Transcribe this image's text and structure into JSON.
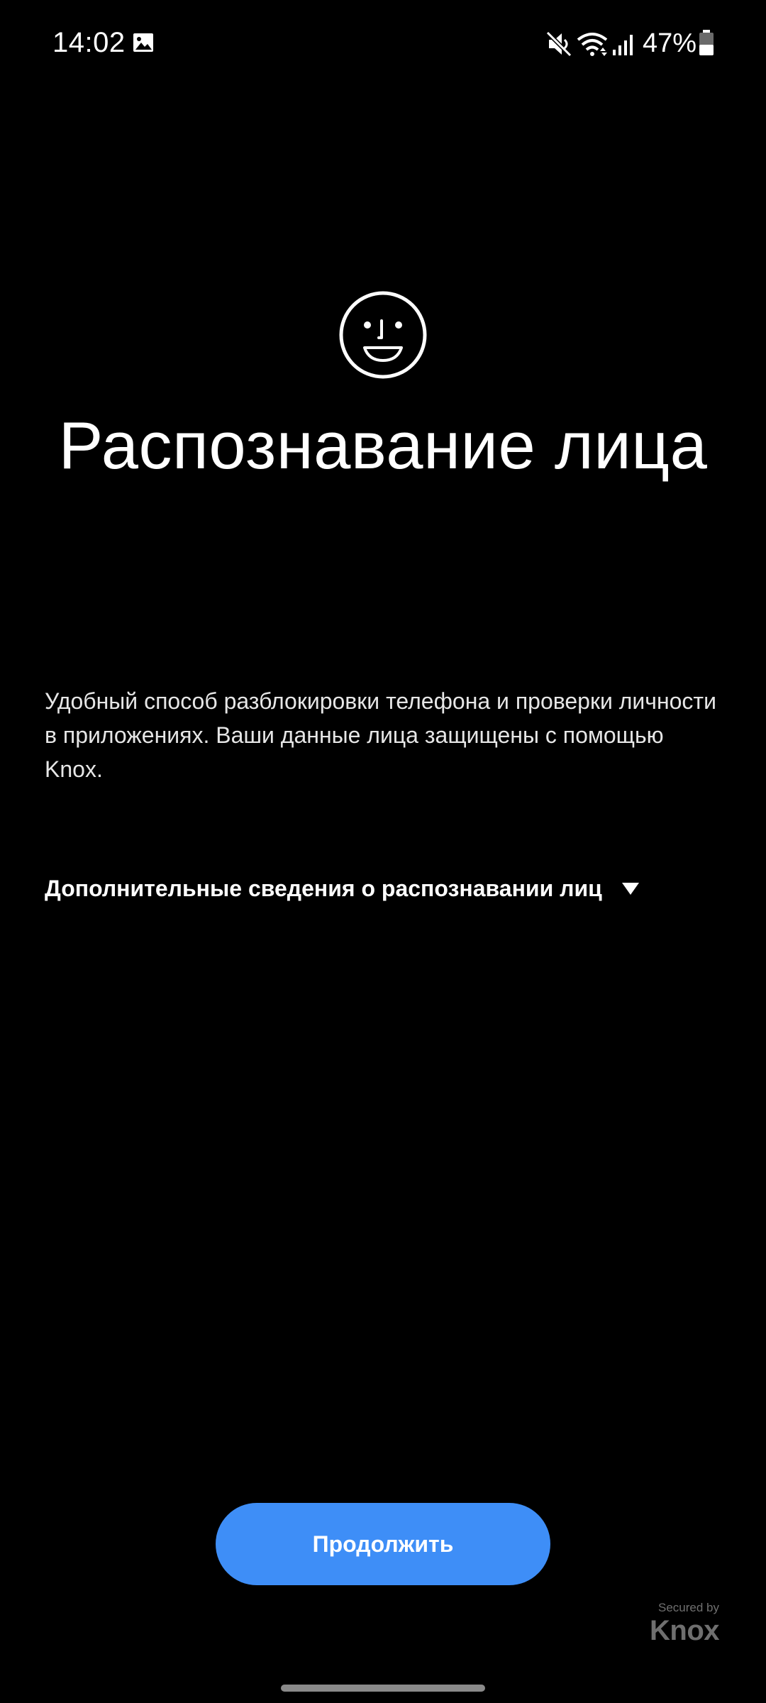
{
  "status_bar": {
    "time": "14:02",
    "battery_percent": "47%",
    "battery_level": 0.47,
    "icons": [
      "gallery-icon",
      "mute-icon",
      "wifi-icon",
      "signal-icon",
      "battery-icon"
    ]
  },
  "main": {
    "icon": "face-icon",
    "title": "Распознавание лица",
    "description": "Удобный способ разблокировки телефона и проверки личности в приложениях. Ваши данные лица защищены с помощью Knox.",
    "more_info_label": "Дополнительные сведения о распознавании лиц",
    "more_info_icon": "triangle-down-icon"
  },
  "footer": {
    "continue_label": "Продолжить",
    "knox_secured_by": "Secured by",
    "knox_name": "Knox"
  },
  "colors": {
    "background": "#000000",
    "accent": "#3e8ef7",
    "text": "#ffffff",
    "muted": "#6f6f6f"
  }
}
